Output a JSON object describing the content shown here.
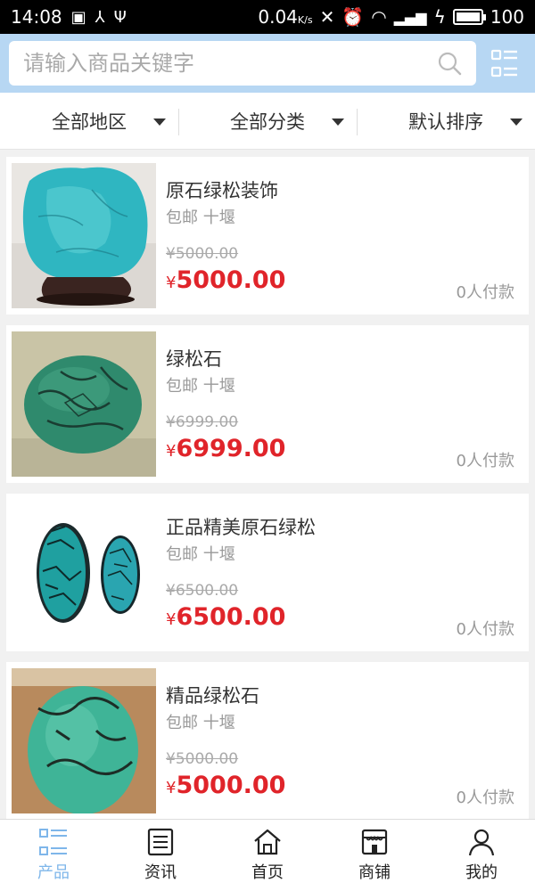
{
  "status_bar": {
    "time": "14:08",
    "speed": "0.04",
    "speed_unit": "K/s",
    "battery": "100",
    "battery_level": 1.0
  },
  "search": {
    "placeholder": "请输入商品关键字"
  },
  "filters": [
    {
      "label": "全部地区"
    },
    {
      "label": "全部分类"
    },
    {
      "label": "默认排序"
    }
  ],
  "products": [
    {
      "title": "原石绿松装饰",
      "shipping": "包邮 十堰",
      "old_price": "¥5000.00",
      "currency": "¥",
      "price": "5000.00",
      "paid": "0人付款",
      "image": "turquoise-rough-stone"
    },
    {
      "title": "绿松石",
      "shipping": "包邮 十堰",
      "old_price": "¥6999.00",
      "currency": "¥",
      "price": "6999.00",
      "paid": "0人付款",
      "image": "turquoise-egg"
    },
    {
      "title": "正品精美原石绿松",
      "shipping": "包邮 十堰",
      "old_price": "¥6500.00",
      "currency": "¥",
      "price": "6500.00",
      "paid": "0人付款",
      "image": "turquoise-cabochons"
    },
    {
      "title": "精品绿松石",
      "shipping": "包邮 十堰",
      "old_price": "¥5000.00",
      "currency": "¥",
      "price": "5000.00",
      "paid": "0人付款",
      "image": "turquoise-oval"
    }
  ],
  "tabs": [
    {
      "label": "产品",
      "icon": "list-icon",
      "active": true
    },
    {
      "label": "资讯",
      "icon": "news-icon",
      "active": false
    },
    {
      "label": "首页",
      "icon": "home-icon",
      "active": false
    },
    {
      "label": "商铺",
      "icon": "shop-icon",
      "active": false
    },
    {
      "label": "我的",
      "icon": "user-icon",
      "active": false
    }
  ],
  "colors": {
    "header_bg": "#b7d7f3",
    "price_red": "#e0242a",
    "tab_active": "#7eb6ea"
  }
}
